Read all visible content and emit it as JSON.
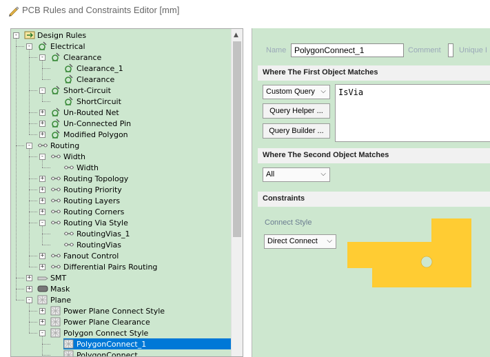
{
  "window": {
    "title": "PCB Rules and Constraints Editor [mm]"
  },
  "tree": {
    "items": [
      {
        "label": "Design Rules"
      },
      {
        "label": "Electrical"
      },
      {
        "label": "Clearance"
      },
      {
        "label": "Clearance_1"
      },
      {
        "label": "Clearance"
      },
      {
        "label": "Short-Circuit"
      },
      {
        "label": "ShortCircuit"
      },
      {
        "label": "Un-Routed Net"
      },
      {
        "label": "Un-Connected Pin"
      },
      {
        "label": "Modified Polygon"
      },
      {
        "label": "Routing"
      },
      {
        "label": "Width"
      },
      {
        "label": "Width"
      },
      {
        "label": "Routing Topology"
      },
      {
        "label": "Routing Priority"
      },
      {
        "label": "Routing Layers"
      },
      {
        "label": "Routing Corners"
      },
      {
        "label": "Routing Via Style"
      },
      {
        "label": "RoutingVias_1"
      },
      {
        "label": "RoutingVias"
      },
      {
        "label": "Fanout Control"
      },
      {
        "label": "Differential Pairs Routing"
      },
      {
        "label": "SMT"
      },
      {
        "label": "Mask"
      },
      {
        "label": "Plane"
      },
      {
        "label": "Power Plane Connect Style"
      },
      {
        "label": "Power Plane Clearance"
      },
      {
        "label": "Polygon Connect Style"
      },
      {
        "label": "PolygonConnect_1"
      },
      {
        "label": "PolygonConnect"
      }
    ]
  },
  "rule": {
    "name_label": "Name",
    "name_value": "PolygonConnect_1",
    "comment_label": "Comment",
    "unique_id_label": "Unique I",
    "first_match": {
      "header": "Where The First Object Matches",
      "scope_value": "Custom Query",
      "query_helper_label": "Query Helper ...",
      "query_builder_label": "Query Builder ...",
      "query_text": "IsVia"
    },
    "second_match": {
      "header": "Where The Second Object Matches",
      "scope_value": "All"
    },
    "constraints": {
      "header": "Constraints",
      "connect_style_label": "Connect Style",
      "connect_style_value": "Direct Connect"
    }
  },
  "colors": {
    "panel_bg": "#cde7cf",
    "selection": "#0078d7",
    "copper": "#ffcc33"
  }
}
